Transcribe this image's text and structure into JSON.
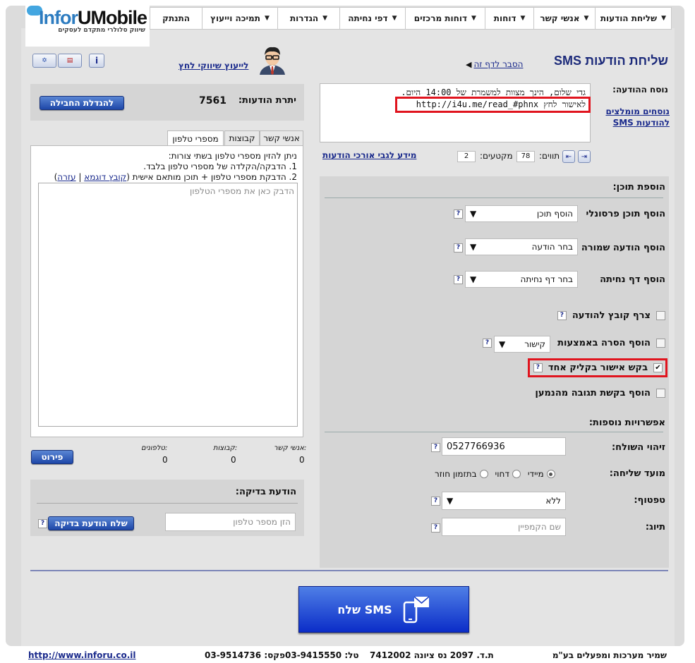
{
  "nav": {
    "items": [
      {
        "label": "שליחת הודעות",
        "arrow": "▼"
      },
      {
        "label": "אנשי קשר",
        "arrow": "▼"
      },
      {
        "label": "דוחות",
        "arrow": "▼"
      },
      {
        "label": "דוחות מרכזים",
        "arrow": "▼"
      },
      {
        "label": "דפי נחיתה",
        "arrow": "▼"
      },
      {
        "label": "הגדרות",
        "arrow": "▼"
      },
      {
        "label": "תמיכה וייעוץ",
        "arrow": "▼"
      },
      {
        "label": "התנתק",
        "arrow": ""
      }
    ]
  },
  "logo": {
    "brand_a": "Infor",
    "brand_b": "UMobile",
    "tagline": "שיווק סלולרי מתקדם לעסקים"
  },
  "header": {
    "title": "שליחת הודעות SMS",
    "explain_link": "הסבר לדף זה",
    "consult_link": "לייעוץ שיווקי לחץ",
    "flag_il": "✡",
    "flag_us": "▤",
    "info": "i"
  },
  "message": {
    "label": "נוסח ההודעה:",
    "line1": "גדי שלום, הינך מצוות למשמרת של 14:00 היום.",
    "line2": "לאישור לחץ http://i4u.me/read_#phnx",
    "templates_link": "נוסחים מומלצים להודעות SMS",
    "chars_label": "תווים:",
    "chars_value": "78",
    "segments_label": "מקטעים:",
    "segments_value": "2",
    "long_msg_link": "מידע לגבי אורכי הודעות",
    "dir_rtl": "⇤",
    "dir_ltr": "⇥"
  },
  "content": {
    "section_title": "הוספת תוכן:",
    "personal_label": "הוסף תוכן פרסונלי",
    "personal_value": "הוסף תוכן",
    "saved_label": "הוסף הודעה שמורה",
    "saved_value": "בחר הודעה",
    "landing_label": "הוסף דף נחיתה",
    "landing_value": "בחר דף נחיתה",
    "attach_label": "צרף קובץ להודעה",
    "remove_label": "הוסף הסרה באמצעות",
    "remove_value": "קישור",
    "confirm_label": "בקש אישור בקליק אחד",
    "reply_label": "הוסף בקשת תגובה מהנמען",
    "help": "?",
    "check": "✔"
  },
  "extra": {
    "section_title": "אפשרויות נוספות:",
    "sender_label": "זיהוי השולח:",
    "sender_value": "0527766936",
    "timing_label": "מועד שליחה:",
    "timing_now": "מיידי",
    "timing_delay": "דחוי",
    "timing_cycle": "בתזמון חוזר",
    "topic_label": "טפטוף:",
    "topic_value": "ללא",
    "tag_label": "תיוג:",
    "tag_placeholder": "שם הקמפיין"
  },
  "balance": {
    "label": "יתרת הודעות:",
    "value": "7561",
    "upgrade_button": "להגדלת החבילה"
  },
  "recipients": {
    "tabs": [
      "אנשי קשר",
      "קבוצות",
      "מספרי טלפון"
    ],
    "instr1": "ניתן להזין מספרי טלפון בשתי צורות:",
    "instr2": "1. הדבקה/הקלדה של מספרי טלפון בלבד.",
    "instr3a": "2. הדבקת מספרי טלפון + תוכן מותאם אישית (",
    "sample_file": "קובץ דוגמא",
    "sep": " | ",
    "help_link": "עזרה",
    "instr3b": ")",
    "placeholder": "הדבק כאן את מספרי הטלפון",
    "count_contacts_label": "אנשי קשר:",
    "count_groups_label": "קבוצות:",
    "count_phones_label": "טלפונים:",
    "count_contacts": "0",
    "count_groups": "0",
    "count_phones": "0",
    "details_button": "פירוט"
  },
  "test": {
    "title": "הודעת בדיקה:",
    "phone_placeholder": "הזן מספר טלפון",
    "send_button": "שלח הודעת בדיקה"
  },
  "send_button": "שלח SMS",
  "footer": {
    "company": "שמיר מערכות ומפעלים בע\"מ",
    "address": "ת.ד. 2097 נס ציונה 7412002",
    "tel": "טל: 03-9415550",
    "fax": "פקס: 03-9514736",
    "url": "http://www.inforu.co.il"
  }
}
